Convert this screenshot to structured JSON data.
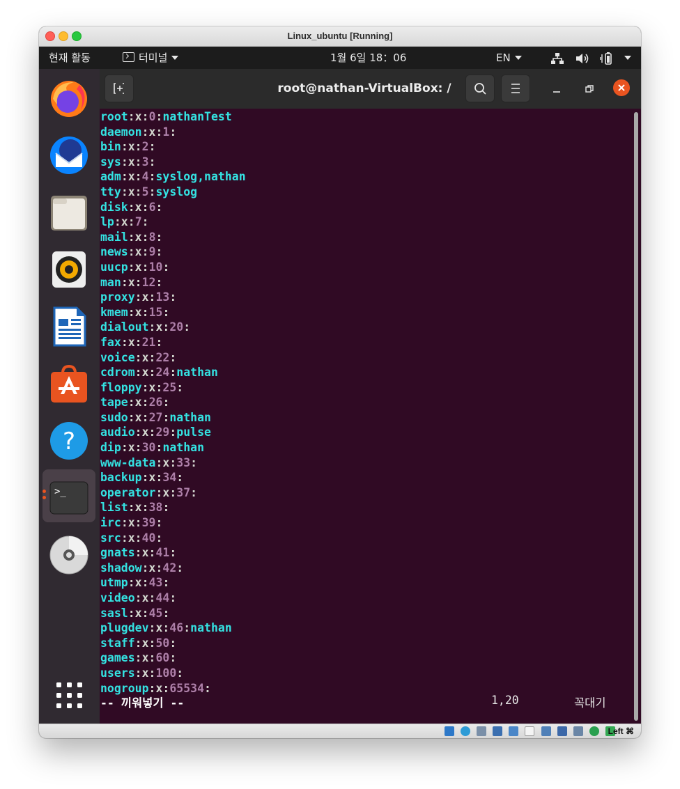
{
  "window": {
    "title": "Linux_ubuntu [Running]"
  },
  "topbar": {
    "activities": "현재 활동",
    "app_menu": "터미널",
    "clock": "1월 6일  18：06",
    "language": "EN"
  },
  "dock": {
    "items": [
      "firefox-icon",
      "thunderbird-icon",
      "files-icon",
      "rhythmbox-icon",
      "libreoffice-writer-icon",
      "ubuntu-software-icon",
      "help-icon",
      "terminal-icon",
      "dvd-icon"
    ]
  },
  "terminal": {
    "title": "root@nathan-VirtualBox: /",
    "lines": [
      {
        "name": "root",
        "sep1": ":x:",
        "gid": "0",
        "sep2": ":",
        "members": "nathanTest"
      },
      {
        "name": "daemon",
        "sep1": ":x:",
        "gid": "1",
        "sep2": ":",
        "members": ""
      },
      {
        "name": "bin",
        "sep1": ":x:",
        "gid": "2",
        "sep2": ":",
        "members": ""
      },
      {
        "name": "sys",
        "sep1": ":x:",
        "gid": "3",
        "sep2": ":",
        "members": ""
      },
      {
        "name": "adm",
        "sep1": ":x:",
        "gid": "4",
        "sep2": ":",
        "members": "syslog,nathan"
      },
      {
        "name": "tty",
        "sep1": ":x:",
        "gid": "5",
        "sep2": ":",
        "members": "syslog"
      },
      {
        "name": "disk",
        "sep1": ":x:",
        "gid": "6",
        "sep2": ":",
        "members": ""
      },
      {
        "name": "lp",
        "sep1": ":x:",
        "gid": "7",
        "sep2": ":",
        "members": ""
      },
      {
        "name": "mail",
        "sep1": ":x:",
        "gid": "8",
        "sep2": ":",
        "members": ""
      },
      {
        "name": "news",
        "sep1": ":x:",
        "gid": "9",
        "sep2": ":",
        "members": ""
      },
      {
        "name": "uucp",
        "sep1": ":x:",
        "gid": "10",
        "sep2": ":",
        "members": ""
      },
      {
        "name": "man",
        "sep1": ":x:",
        "gid": "12",
        "sep2": ":",
        "members": ""
      },
      {
        "name": "proxy",
        "sep1": ":x:",
        "gid": "13",
        "sep2": ":",
        "members": ""
      },
      {
        "name": "kmem",
        "sep1": ":x:",
        "gid": "15",
        "sep2": ":",
        "members": ""
      },
      {
        "name": "dialout",
        "sep1": ":x:",
        "gid": "20",
        "sep2": ":",
        "members": ""
      },
      {
        "name": "fax",
        "sep1": ":x:",
        "gid": "21",
        "sep2": ":",
        "members": ""
      },
      {
        "name": "voice",
        "sep1": ":x:",
        "gid": "22",
        "sep2": ":",
        "members": ""
      },
      {
        "name": "cdrom",
        "sep1": ":x:",
        "gid": "24",
        "sep2": ":",
        "members": "nathan"
      },
      {
        "name": "floppy",
        "sep1": ":x:",
        "gid": "25",
        "sep2": ":",
        "members": ""
      },
      {
        "name": "tape",
        "sep1": ":x:",
        "gid": "26",
        "sep2": ":",
        "members": ""
      },
      {
        "name": "sudo",
        "sep1": ":x:",
        "gid": "27",
        "sep2": ":",
        "members": "nathan"
      },
      {
        "name": "audio",
        "sep1": ":x:",
        "gid": "29",
        "sep2": ":",
        "members": "pulse"
      },
      {
        "name": "dip",
        "sep1": ":x:",
        "gid": "30",
        "sep2": ":",
        "members": "nathan"
      },
      {
        "name": "www-data",
        "sep1": ":x:",
        "gid": "33",
        "sep2": ":",
        "members": ""
      },
      {
        "name": "backup",
        "sep1": ":x:",
        "gid": "34",
        "sep2": ":",
        "members": ""
      },
      {
        "name": "operator",
        "sep1": ":x:",
        "gid": "37",
        "sep2": ":",
        "members": ""
      },
      {
        "name": "list",
        "sep1": ":x:",
        "gid": "38",
        "sep2": ":",
        "members": ""
      },
      {
        "name": "irc",
        "sep1": ":x:",
        "gid": "39",
        "sep2": ":",
        "members": ""
      },
      {
        "name": "src",
        "sep1": ":x:",
        "gid": "40",
        "sep2": ":",
        "members": ""
      },
      {
        "name": "gnats",
        "sep1": ":x:",
        "gid": "41",
        "sep2": ":",
        "members": ""
      },
      {
        "name": "shadow",
        "sep1": ":x:",
        "gid": "42",
        "sep2": ":",
        "members": ""
      },
      {
        "name": "utmp",
        "sep1": ":x:",
        "gid": "43",
        "sep2": ":",
        "members": ""
      },
      {
        "name": "video",
        "sep1": ":x:",
        "gid": "44",
        "sep2": ":",
        "members": ""
      },
      {
        "name": "sasl",
        "sep1": ":x:",
        "gid": "45",
        "sep2": ":",
        "members": ""
      },
      {
        "name": "plugdev",
        "sep1": ":x:",
        "gid": "46",
        "sep2": ":",
        "members": "nathan"
      },
      {
        "name": "staff",
        "sep1": ":x:",
        "gid": "50",
        "sep2": ":",
        "members": ""
      },
      {
        "name": "games",
        "sep1": ":x:",
        "gid": "60",
        "sep2": ":",
        "members": ""
      },
      {
        "name": "users",
        "sep1": ":x:",
        "gid": "100",
        "sep2": ":",
        "members": ""
      },
      {
        "name": "nogroup",
        "sep1": ":x:",
        "gid": "65534",
        "sep2": ":",
        "members": ""
      }
    ],
    "status_mode": "-- 끼워넣기 --",
    "status_position": "1,20",
    "status_scroll": "꼭대기"
  },
  "vbox_statusbar": {
    "host_key": "Left ⌘"
  },
  "colors": {
    "terminal_bg": "#300a24",
    "group_name": "#34e2e2",
    "gid": "#ad7fa8",
    "ubuntu_orange": "#e95420"
  }
}
